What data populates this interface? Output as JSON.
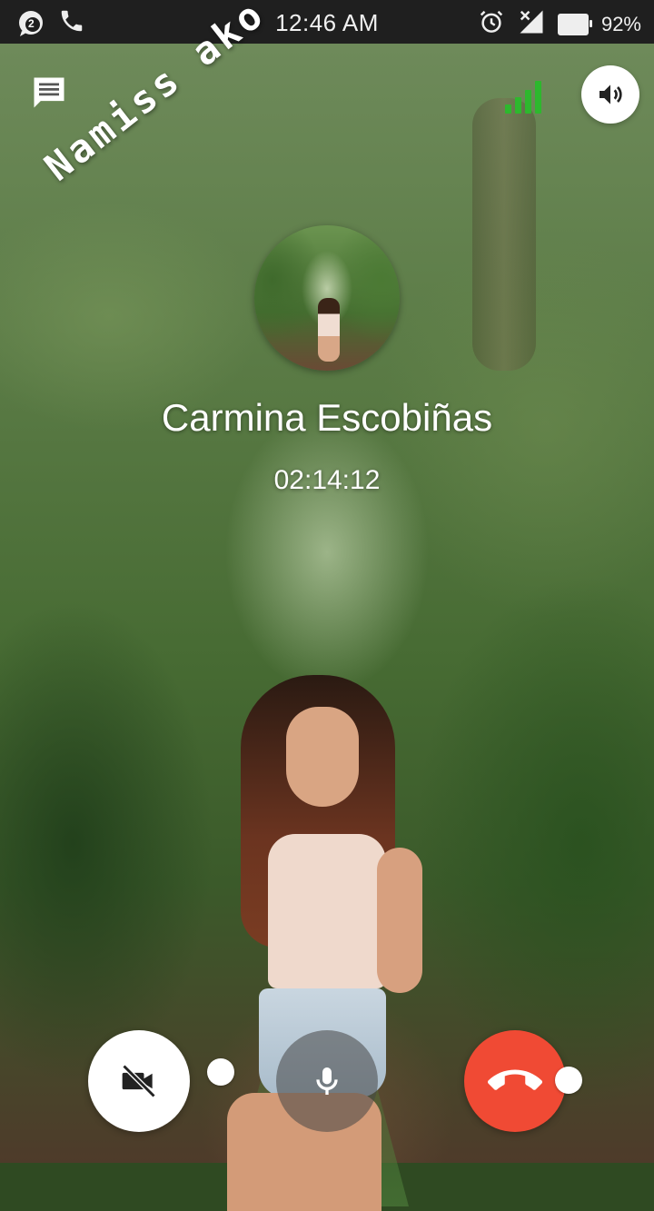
{
  "status_bar": {
    "notification_count": "2",
    "time": "12:46 AM",
    "battery": "92%",
    "icons": [
      "chat-bubble-icon",
      "phone-icon",
      "alarm-icon",
      "signal-off-icon",
      "battery-icon"
    ]
  },
  "sticker": {
    "text": "Namiss ako"
  },
  "caller": {
    "name": "Carmina Escobiñas",
    "timer": "02:14:12"
  },
  "controls": {
    "top": [
      "message-icon",
      "signal-strength-icon",
      "speaker-icon"
    ],
    "bottom": [
      "video-off-icon",
      "mic-icon",
      "end-call-icon"
    ]
  },
  "colors": {
    "status_bar_bg": "#1f1f1f",
    "signal_green": "#2db82d",
    "end_call_red": "#f04a34",
    "mic_button_bg": "rgba(70,70,70,0.55)"
  }
}
